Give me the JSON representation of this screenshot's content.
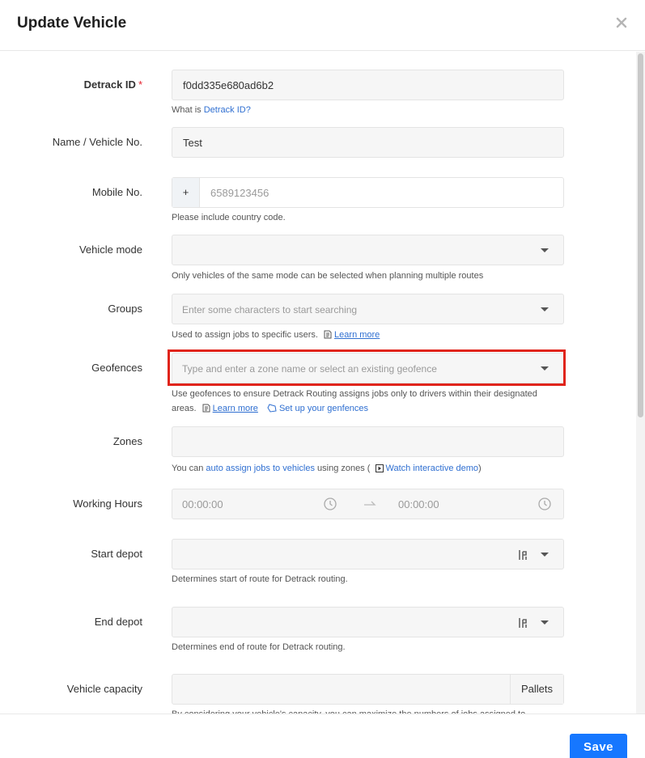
{
  "modal": {
    "title": "Update Vehicle",
    "save_label": "Save"
  },
  "detrack_id": {
    "label": "Detrack ID",
    "required_mark": "*",
    "value": "f0dd335e680ad6b2",
    "help_prefix": "What is ",
    "help_link": "Detrack ID?"
  },
  "name": {
    "label": "Name / Vehicle No.",
    "value": "Test"
  },
  "mobile": {
    "label": "Mobile No.",
    "prefix": "+",
    "placeholder": "6589123456",
    "help": "Please include country code."
  },
  "vehicle_mode": {
    "label": "Vehicle mode",
    "help": "Only vehicles of the same mode can be selected when planning multiple routes"
  },
  "groups": {
    "label": "Groups",
    "placeholder": "Enter some characters to start searching",
    "help": "Used to assign jobs to specific users.",
    "learn_more": "Learn more"
  },
  "geofences": {
    "label": "Geofences",
    "placeholder": "Type and enter a zone name or select an existing geofence",
    "help_line1": "Use geofences to ensure Detrack Routing assigns jobs only to drivers within their designated",
    "help_line2_prefix": "areas.",
    "learn_more": "Learn more",
    "setup_link": "Set up your genfences"
  },
  "zones": {
    "label": "Zones",
    "help_prefix": "You can ",
    "help_link": "auto assign jobs to vehicles",
    "help_mid": " using zones (",
    "demo_link": "Watch interactive demo",
    "help_suffix": ")"
  },
  "working_hours": {
    "label": "Working Hours",
    "start": "00:00:00",
    "end": "00:00:00"
  },
  "start_depot": {
    "label": "Start depot",
    "help": "Determines start of route for Detrack routing."
  },
  "end_depot": {
    "label": "End depot",
    "help": "Determines end of route for Detrack routing."
  },
  "capacity": {
    "label": "Vehicle capacity",
    "unit": "Pallets",
    "help": "By considering your vehicle's capacity, you can maximize the numbers of jobs assigned to"
  }
}
